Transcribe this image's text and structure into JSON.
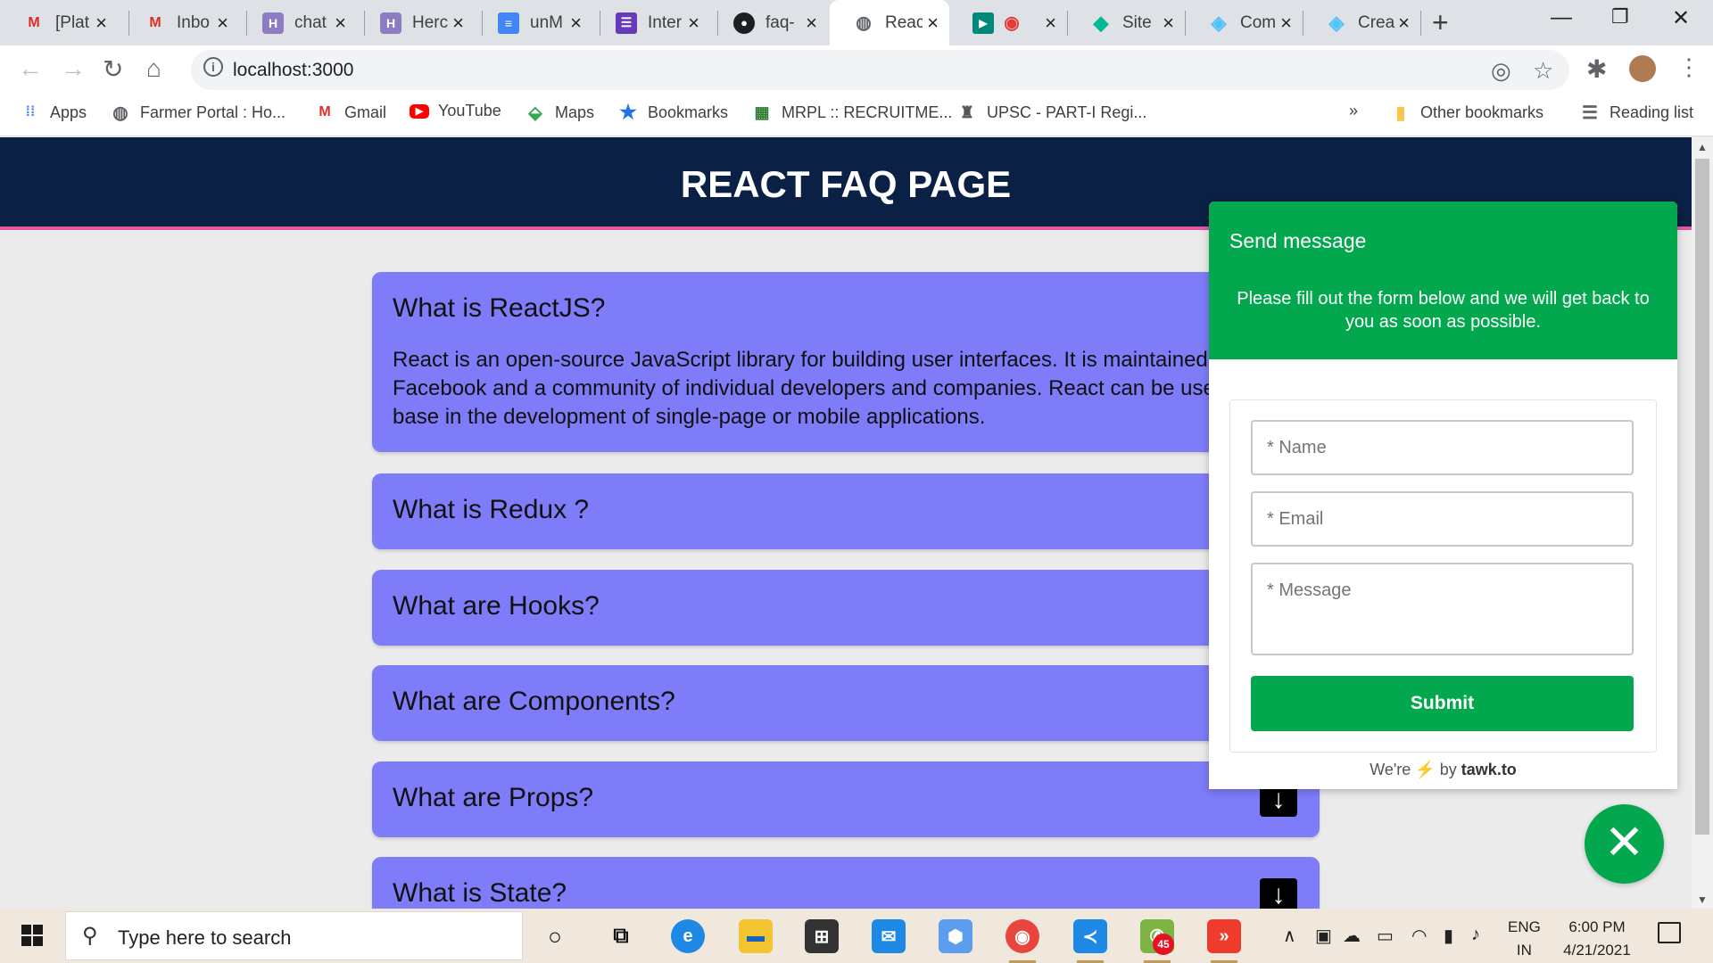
{
  "browser": {
    "tabs": [
      {
        "title": "[Plat",
        "icon": "gmail-icon",
        "color": "#d93025"
      },
      {
        "title": "Inbo",
        "icon": "gmail-icon",
        "color": "#d93025"
      },
      {
        "title": "chat",
        "icon": "heroku-icon",
        "color": "#6762a6"
      },
      {
        "title": "Herc",
        "icon": "heroku-icon",
        "color": "#6762a6"
      },
      {
        "title": "unM",
        "icon": "docs-icon",
        "color": "#4285f4"
      },
      {
        "title": "Inter",
        "icon": "forms-icon",
        "color": "#673ab7"
      },
      {
        "title": "faq-",
        "icon": "github-icon",
        "color": "#1b1f23"
      },
      {
        "title": "Reac",
        "icon": "globe-icon",
        "color": "#5f6368",
        "active": true
      },
      {
        "title": "",
        "icon": "meet-icon",
        "color": "#00897b"
      },
      {
        "title": "Site",
        "icon": "diamond-icon",
        "color": "#00b894"
      },
      {
        "title": "Com",
        "icon": "diamond-icon",
        "color": "#4fc3f7"
      },
      {
        "title": "Crea",
        "icon": "diamond-icon",
        "color": "#4fc3f7"
      }
    ],
    "url": "localhost:3000",
    "bookmarks": [
      {
        "label": "Apps",
        "icon": "apps-grid-icon"
      },
      {
        "label": "Farmer Portal : Ho...",
        "icon": "globe-icon"
      },
      {
        "label": "Gmail",
        "icon": "gmail-icon"
      },
      {
        "label": "YouTube",
        "icon": "youtube-icon"
      },
      {
        "label": "Maps",
        "icon": "maps-icon"
      },
      {
        "label": "Bookmarks",
        "icon": "star-icon"
      },
      {
        "label": "MRPL :: RECRUITME...",
        "icon": "mrpl-icon"
      },
      {
        "label": "UPSC - PART-I Regi...",
        "icon": "emblem-icon"
      }
    ],
    "bookmarks_overflow": "»",
    "other_bookmarks": "Other bookmarks",
    "reading_list": "Reading list"
  },
  "page": {
    "title": "REACT FAQ PAGE",
    "faqs": [
      {
        "question": "What is ReactJS?",
        "answer": "React is an open-source JavaScript library for building user interfaces. It is maintained by Facebook and a community of individual developers and companies. React can be used as a base in the development of single-page or mobile applications."
      },
      {
        "question": "What is Redux ?"
      },
      {
        "question": "What are Hooks?"
      },
      {
        "question": "What are Components?"
      },
      {
        "question": "What are Props?"
      },
      {
        "question": "What is State?"
      }
    ]
  },
  "chat_widget": {
    "title": "Send message",
    "subtitle": "Please fill out the form below and we will get back to you as soon as possible.",
    "fields": {
      "name_placeholder": "* Name",
      "email_placeholder": "* Email",
      "message_placeholder": "* Message"
    },
    "submit_label": "Submit",
    "footer_prefix": "We're",
    "footer_bolt": "⚡",
    "footer_by": "by",
    "footer_brand": "tawk.to",
    "close_symbol": "✕",
    "accent": "#03a84e"
  },
  "taskbar": {
    "search_placeholder": "Type here to search",
    "whatsapp_badge": "45",
    "language": "ENG",
    "region": "IN",
    "time": "6:00 PM",
    "date": "4/21/2021"
  }
}
